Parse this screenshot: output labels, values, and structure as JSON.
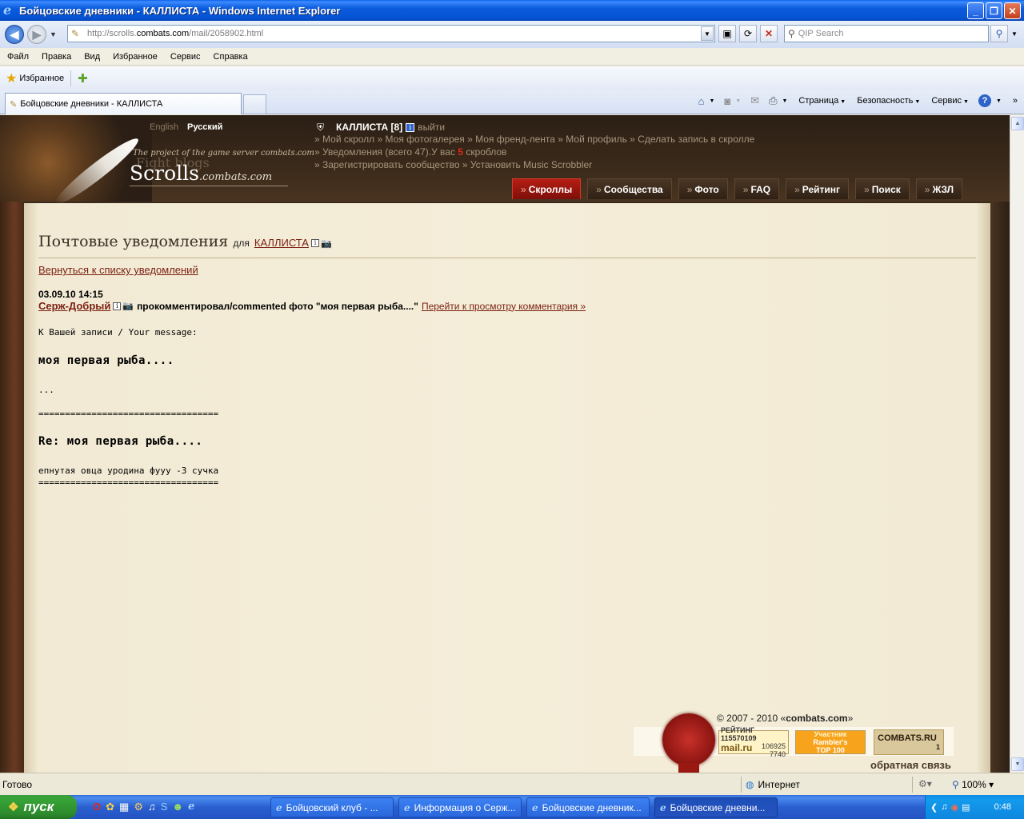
{
  "window": {
    "title": "Бойцовские дневники - КАЛЛИСТА - Windows Internet Explorer",
    "buttons": [
      "_",
      "❐",
      "✕"
    ]
  },
  "addressbar": {
    "url_prefix": "http://scrolls.",
    "url_domain": "combats.com",
    "url_suffix": "/mail/2058902.html",
    "search_placeholder": "QIP Search"
  },
  "menubar": [
    "Файл",
    "Правка",
    "Вид",
    "Избранное",
    "Сервис",
    "Справка"
  ],
  "favbar": {
    "label": "Избранное"
  },
  "tab": {
    "label": "Бойцовские дневники - КАЛЛИСТА"
  },
  "commandbar": {
    "page": "Страница",
    "security": "Безопасность",
    "tools": "Сервис"
  },
  "site": {
    "lang_en": "English",
    "lang_ru": "Русский",
    "logo_sub": "The project of the game server combats.com",
    "logo_ghost": "Fight blogs",
    "logo_main": "Scrolls",
    "logo_tail": ".combats.com",
    "user": {
      "name": "КАЛЛИСТА [8]",
      "logout": "выйти"
    },
    "links_row1": "» Мой скролл » Моя фотогалерея » Моя френд-лента » Мой профиль » Сделать запись в скролле",
    "links_row2_a": "» Уведомления (всего 47).У вас ",
    "links_row2_num": "5",
    "links_row2_b": " скроблов",
    "links_row3": "» Зарегистрировать сообщество » Установить Music Scrobbler",
    "nav": [
      "Скроллы",
      "Сообщества",
      "Фото",
      "FAQ",
      "Рейтинг",
      "Поиск",
      "ЖЗЛ"
    ]
  },
  "content": {
    "title": "Почтовые уведомления",
    "title_for": "для",
    "title_user": "КАЛЛИСТА",
    "back_link": "Вернуться к списку уведомлений",
    "date": "03.09.10 14:15",
    "author": "Серж-Добрый",
    "action": "прокомментировал/commented фото \"моя первая рыба....\"",
    "goto": "Перейти к просмотру комментария »",
    "your_message_label": "К Вашей записи / Your message:",
    "message_title": "моя первая рыба....",
    "message_body": "...",
    "separator": "==================================",
    "reply_title": "Re: моя первая рыба....",
    "reply_body": "епнутая овца уродина фууу -3 сучка",
    "separator2": "=================================="
  },
  "footer": {
    "copyright_a": "© 2007 - 2010 «",
    "copyright_b": "combats.com",
    "copyright_c": "»",
    "mail_counter": {
      "label": "РЕЙТИНГ",
      "v1": "115570109",
      "v2": "106925",
      "v3": "7740",
      "brand": "mail.ru"
    },
    "rambler": {
      "l1": "Участник",
      "l2": "Rambler's",
      "l3": "TOP 100"
    },
    "combats_counter": {
      "brand": "COMBATS.RU",
      "value": "1"
    },
    "feedback": "обратная связь"
  },
  "statusbar": {
    "status": "Готово",
    "zone": "Интернет",
    "zoom": "100%"
  },
  "taskbar": {
    "start": "пуск",
    "items": [
      "Бойцовский клуб - ...",
      "Информация о Серж...",
      "Бойцовские дневник...",
      "Бойцовские дневни..."
    ],
    "time": "0:48"
  }
}
